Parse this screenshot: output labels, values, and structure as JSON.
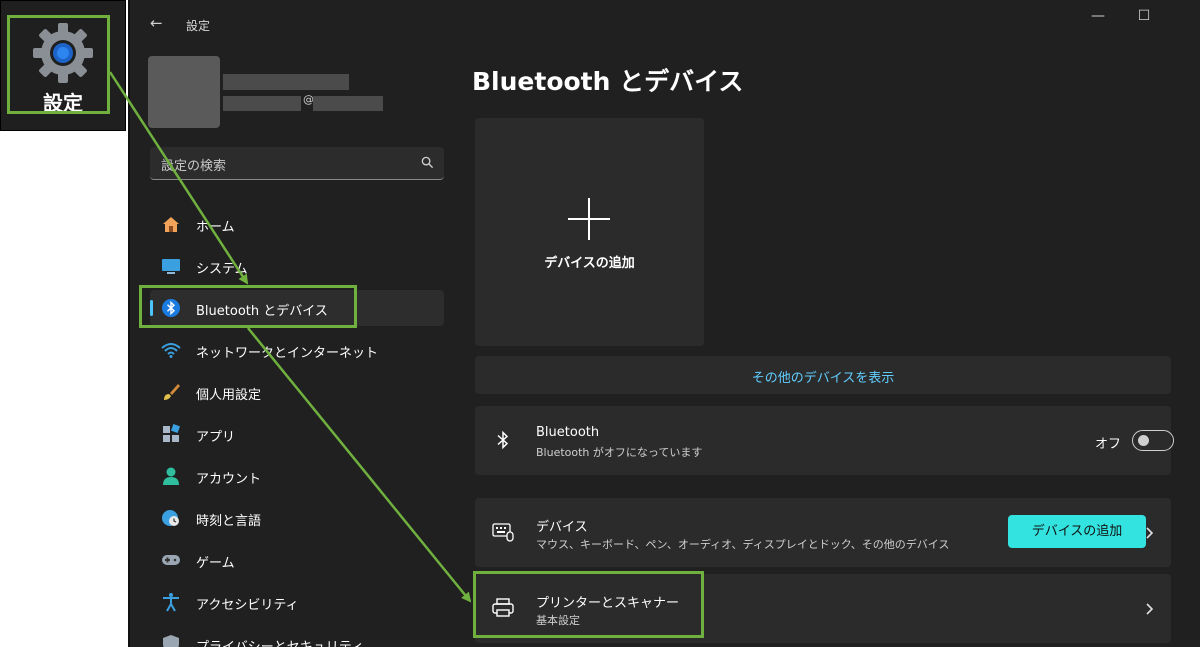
{
  "app_icon": {
    "label": "設定"
  },
  "window": {
    "title": "設定",
    "controls": {
      "minimize": "—",
      "maximize": "☐"
    }
  },
  "profile": {
    "at_sign": "@"
  },
  "search": {
    "placeholder": "設定の検索"
  },
  "sidebar": {
    "items": [
      {
        "label": "ホーム",
        "icon": "home-icon",
        "active": false
      },
      {
        "label": "システム",
        "icon": "system-icon",
        "active": false
      },
      {
        "label": "Bluetooth とデバイス",
        "icon": "bluetooth-icon",
        "active": true
      },
      {
        "label": "ネットワークとインターネット",
        "icon": "wifi-icon",
        "active": false
      },
      {
        "label": "個人用設定",
        "icon": "brush-icon",
        "active": false
      },
      {
        "label": "アプリ",
        "icon": "apps-icon",
        "active": false
      },
      {
        "label": "アカウント",
        "icon": "account-icon",
        "active": false
      },
      {
        "label": "時刻と言語",
        "icon": "globe-clock-icon",
        "active": false
      },
      {
        "label": "ゲーム",
        "icon": "gamepad-icon",
        "active": false
      },
      {
        "label": "アクセシビリティ",
        "icon": "accessibility-icon",
        "active": false
      },
      {
        "label": "プライバシーとセキュリティ",
        "icon": "shield-icon",
        "active": false
      }
    ]
  },
  "main": {
    "title": "Bluetooth とデバイス",
    "add_device_tile": {
      "label": "デバイスの追加"
    },
    "more_devices_link": "その他のデバイスを表示",
    "bluetooth_card": {
      "title": "Bluetooth",
      "subtitle": "Bluetooth がオフになっています",
      "toggle_label": "オフ",
      "toggle_on": false
    },
    "devices_card": {
      "title": "デバイス",
      "subtitle": "マウス、キーボード、ペン、オーディオ、ディスプレイとドック、その他のデバイス",
      "button_label": "デバイスの追加"
    },
    "printers_card": {
      "title": "プリンターとスキャナー",
      "subtitle": "基本設定"
    }
  },
  "colors": {
    "window_bg": "#202020",
    "card_bg": "#2b2b2b",
    "accent": "#4cc2ff",
    "link": "#60cdff",
    "button": "#33e3e0",
    "callout": "#6fb03f"
  }
}
